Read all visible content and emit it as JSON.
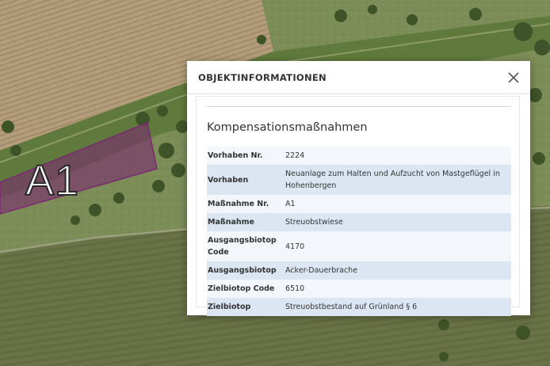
{
  "map": {
    "label": "A1",
    "colors": {
      "area": "#7a2a70"
    }
  },
  "popup": {
    "title": "OBJEKTINFORMATIONEN",
    "close_icon": "close-icon",
    "section_title": "Kompensationsmaßnahmen",
    "rows": [
      {
        "key": "Vorhaben Nr.",
        "value": "2224"
      },
      {
        "key": "Vorhaben",
        "value": "Neuanlage zum Halten und Aufzucht von Mastgeflügel in Hohenbergen"
      },
      {
        "key": "Maßnahme Nr.",
        "value": "A1"
      },
      {
        "key": "Maßnahme",
        "value": "Streuobstwiese"
      },
      {
        "key": "Ausgangsbiotop Code",
        "value": "4170"
      },
      {
        "key": "Ausgangsbiotop",
        "value": "Acker-Dauerbrache"
      },
      {
        "key": "Zielbiotop Code",
        "value": "6510"
      },
      {
        "key": "Zielbiotop",
        "value": "Streuobstbestand auf Grünland § 6"
      }
    ]
  }
}
